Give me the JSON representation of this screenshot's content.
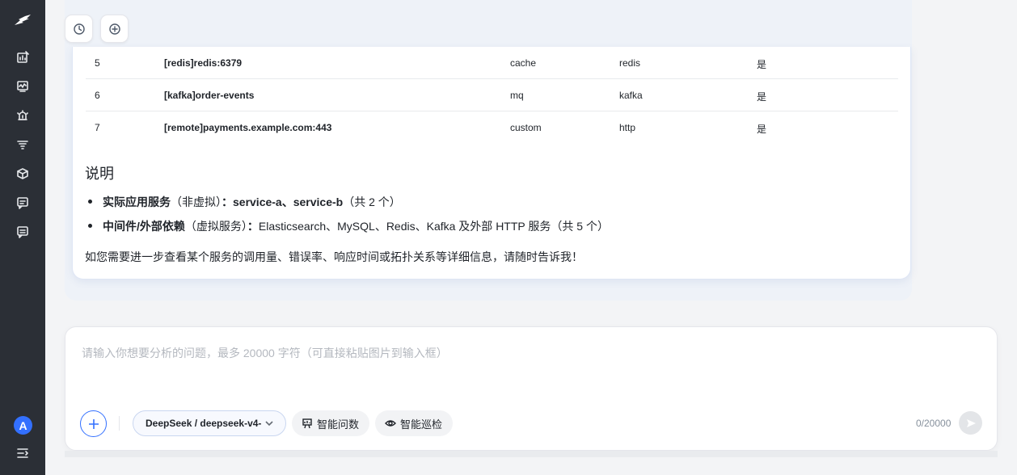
{
  "sidebar": {
    "icons": [
      "logo-icon",
      "chart-edit-icon",
      "monitor-icon",
      "alarm-icon",
      "filter-list-icon",
      "cube-icon",
      "message-icon",
      "message-alt-icon"
    ],
    "avatar_letter": "A",
    "collapse_icon": "collapse-menu-icon"
  },
  "topbar": {
    "history_icon": "history-icon",
    "new_chat_icon": "add-circle-icon"
  },
  "table": {
    "rows": [
      {
        "idx": "5",
        "name": "[redis]redis:6379",
        "type": "cache",
        "component": "redis",
        "virtual": "是"
      },
      {
        "idx": "6",
        "name": "[kafka]order-events",
        "type": "mq",
        "component": "kafka",
        "virtual": "是"
      },
      {
        "idx": "7",
        "name": "[remote]payments.example.com:443",
        "type": "custom",
        "component": "http",
        "virtual": "是"
      }
    ]
  },
  "notes": {
    "heading": "说明",
    "bullet1": {
      "label": "实际应用服务",
      "paren": "（非虚拟）",
      "colon": "：",
      "services": "service-a、service-b",
      "count": "（共 2 个）"
    },
    "bullet2": {
      "label": "中间件/外部依赖",
      "paren": "（虚拟服务）",
      "colon": "：",
      "text": "Elasticsearch、MySQL、Redis、Kafka 及外部 HTTP 服务（共 5 个）"
    },
    "closing": "如您需要进一步查看某个服务的调用量、错误率、响应时间或拓扑关系等详细信息，请随时告诉我！"
  },
  "input": {
    "placeholder": "请输入你想要分析的问题，最多 20000 字符（可直接粘贴图片到输入框）",
    "model": "DeepSeek / deepseek-v4-",
    "ask_label": "智能问数",
    "patrol_label": "智能巡检",
    "counter": "0/20000"
  },
  "colors": {
    "sidebar_bg": "#2b2f36",
    "accent": "#3370ff",
    "page_bg": "#f3f4f6"
  }
}
